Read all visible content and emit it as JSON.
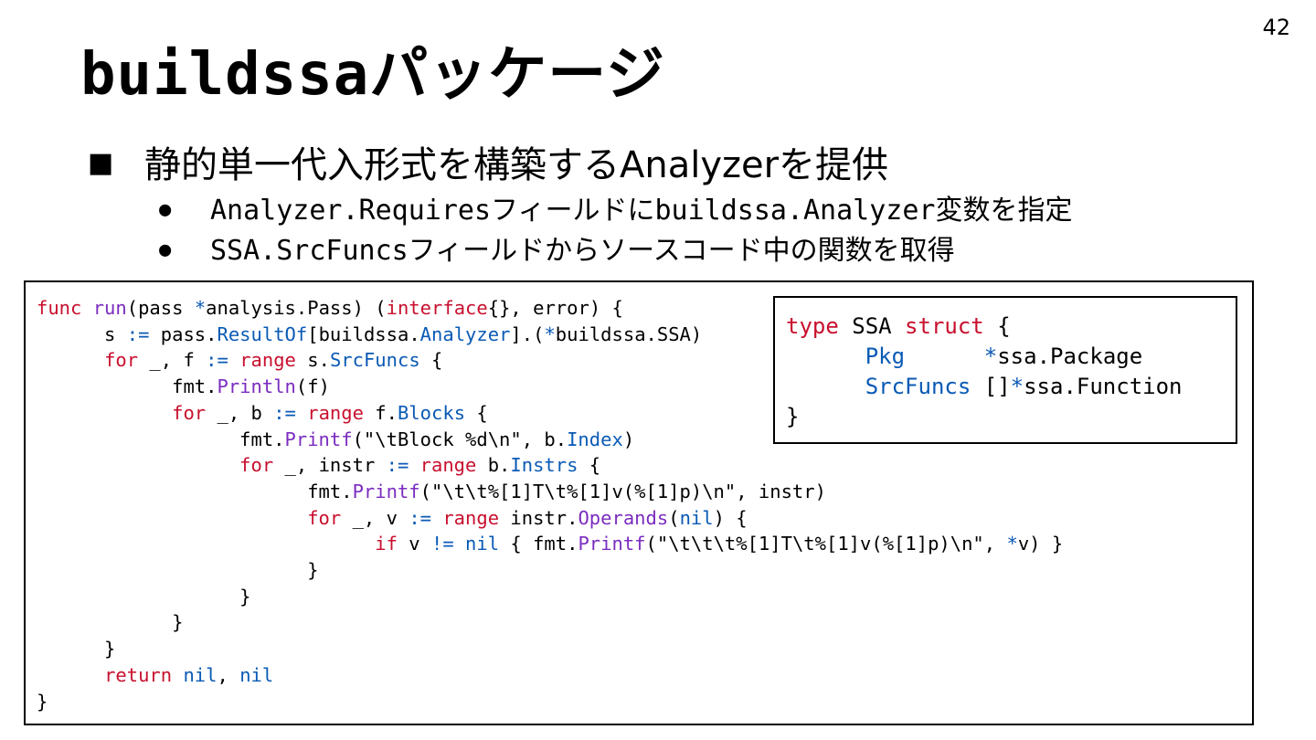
{
  "slide": {
    "page_number": "42",
    "title": "buildssaパッケージ",
    "bullet_main": "静的単一代入形式を構築するAnalyzerを提供",
    "bullet_sub_1": "Analyzer.Requiresフィールドにbuildssa.Analyzer変数を指定",
    "bullet_sub_2": "SSA.SrcFuncsフィールドからソースコード中の関数を取得",
    "square_bullet": "■",
    "dot_bullet": "●"
  },
  "code_main": [
    "func run(pass *analysis.Pass) (interface{}, error) {",
    "      s := pass.ResultOf[buildssa.Analyzer].(*buildssa.SSA)",
    "      for _, f := range s.SrcFuncs {",
    "            fmt.Println(f)",
    "            for _, b := range f.Blocks {",
    "                  fmt.Printf(\"\\tBlock %d\\n\", b.Index)",
    "                  for _, instr := range b.Instrs {",
    "                        fmt.Printf(\"\\t\\t%[1]T\\t%[1]v(%[1]p)\\n\", instr)",
    "                        for _, v := range instr.Operands(nil) {",
    "                              if v != nil { fmt.Printf(\"\\t\\t\\t%[1]T\\t%[1]v(%[1]p)\\n\", *v) }",
    "                        }",
    "                  }",
    "            }",
    "      }",
    "      return nil, nil",
    "}"
  ],
  "code_type": [
    "type SSA struct {",
    "      Pkg      *ssa.Package",
    "      SrcFuncs []*ssa.Function",
    "}"
  ],
  "colors": {
    "keyword": "#c8102e",
    "function": "#7b2cbf",
    "identifier": "#0a5ab5",
    "text": "#000000"
  }
}
